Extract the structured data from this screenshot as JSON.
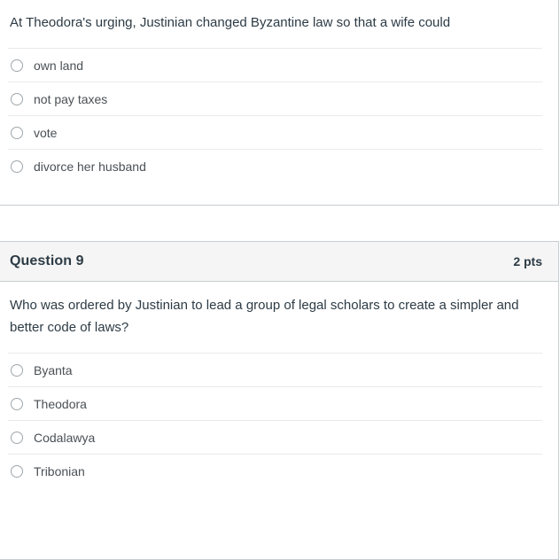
{
  "quiz": {
    "questions": [
      {
        "header_visible": false,
        "title": "",
        "points": "",
        "text": "At Theodora's urging, Justinian changed Byzantine law so that a wife could",
        "options": [
          {
            "label": "own land",
            "selected": false
          },
          {
            "label": "not pay taxes",
            "selected": false
          },
          {
            "label": "vote",
            "selected": false
          },
          {
            "label": "divorce her husband",
            "selected": false
          }
        ]
      },
      {
        "header_visible": true,
        "title": "Question 9",
        "points": "2 pts",
        "text": "Who was ordered by Justinian to lead a group of legal scholars to create a simpler and better code of laws?",
        "options": [
          {
            "label": "Byanta",
            "selected": false
          },
          {
            "label": "Theodora",
            "selected": false
          },
          {
            "label": "Codalawya",
            "selected": false
          },
          {
            "label": "Tribonian",
            "selected": false
          }
        ]
      }
    ]
  },
  "colors": {
    "page_background": "#ffffff",
    "card_border": "#c7cdd1",
    "header_background": "#f5f5f5",
    "divider": "#e8eaec",
    "text": "#2d3b45",
    "option_text": "#4a5055",
    "radio_border": "#9ea6ab"
  }
}
